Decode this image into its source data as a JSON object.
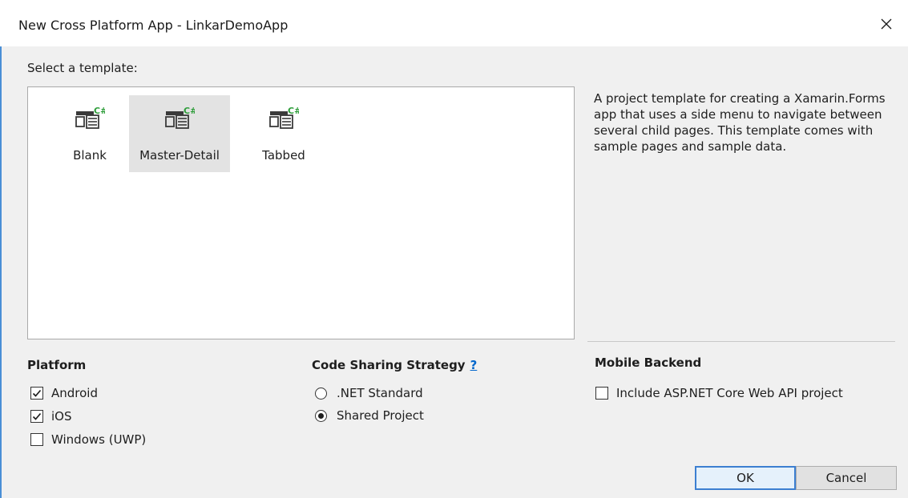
{
  "window": {
    "title": "New Cross Platform App - LinkarDemoApp",
    "close_glyph": "✕"
  },
  "templates": {
    "label": "Select a template:",
    "items": [
      {
        "label": "Blank",
        "selected": false
      },
      {
        "label": "Master-Detail",
        "selected": true
      },
      {
        "label": "Tabbed",
        "selected": false
      }
    ],
    "icon_badge": "C#",
    "description": "A project template for creating a Xamarin.Forms app that uses a side menu to navigate between several child pages. This template comes with sample pages and sample data."
  },
  "platform": {
    "title": "Platform",
    "options": [
      {
        "label": "Android",
        "checked": true
      },
      {
        "label": "iOS",
        "checked": true
      },
      {
        "label": "Windows (UWP)",
        "checked": false
      }
    ]
  },
  "code_sharing": {
    "title": "Code Sharing Strategy",
    "help": "?",
    "options": [
      {
        "label": ".NET Standard",
        "selected": false
      },
      {
        "label": "Shared Project",
        "selected": true
      }
    ]
  },
  "mobile_backend": {
    "title": "Mobile Backend",
    "option": {
      "label": "Include ASP.NET Core Web API project",
      "checked": false
    }
  },
  "buttons": {
    "ok": "OK",
    "cancel": "Cancel"
  },
  "colors": {
    "accent": "#3c7fd1",
    "link": "#0066cc",
    "icon_green": "#2e9d3a",
    "icon_dark": "#3a3a3a"
  }
}
